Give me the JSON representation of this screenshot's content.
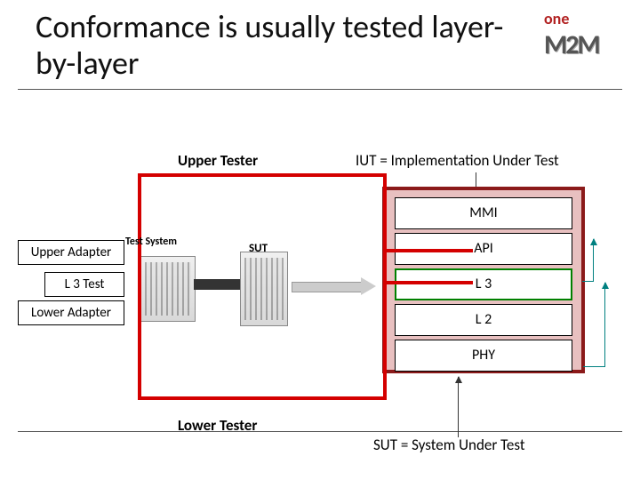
{
  "title": "Conformance is usually tested layer-by-layer",
  "logo": {
    "line1": "one",
    "line2": "M2M"
  },
  "labels": {
    "upper_tester": "Upper Tester",
    "lower_tester": "Lower Tester",
    "upper_adapter": "Upper Adapter",
    "l3_test": "L 3 Test",
    "lower_adapter": "Lower Adapter",
    "test_system": "Test System",
    "sut_small": "SUT"
  },
  "definitions": {
    "iut": "IUT = Implementation Under Test",
    "sut": "SUT = System Under Test"
  },
  "stack": {
    "mmi": "MMI",
    "api": "API",
    "l3": "L 3",
    "l2": "L 2",
    "phy": "PHY"
  },
  "colors": {
    "red_frame": "#d40000",
    "stack_border": "#8b1a1a",
    "stack_fill": "#e8c0c0",
    "iut_highlight": "#008000",
    "teal_arrow": "#008080",
    "logo_red": "#b22222"
  }
}
